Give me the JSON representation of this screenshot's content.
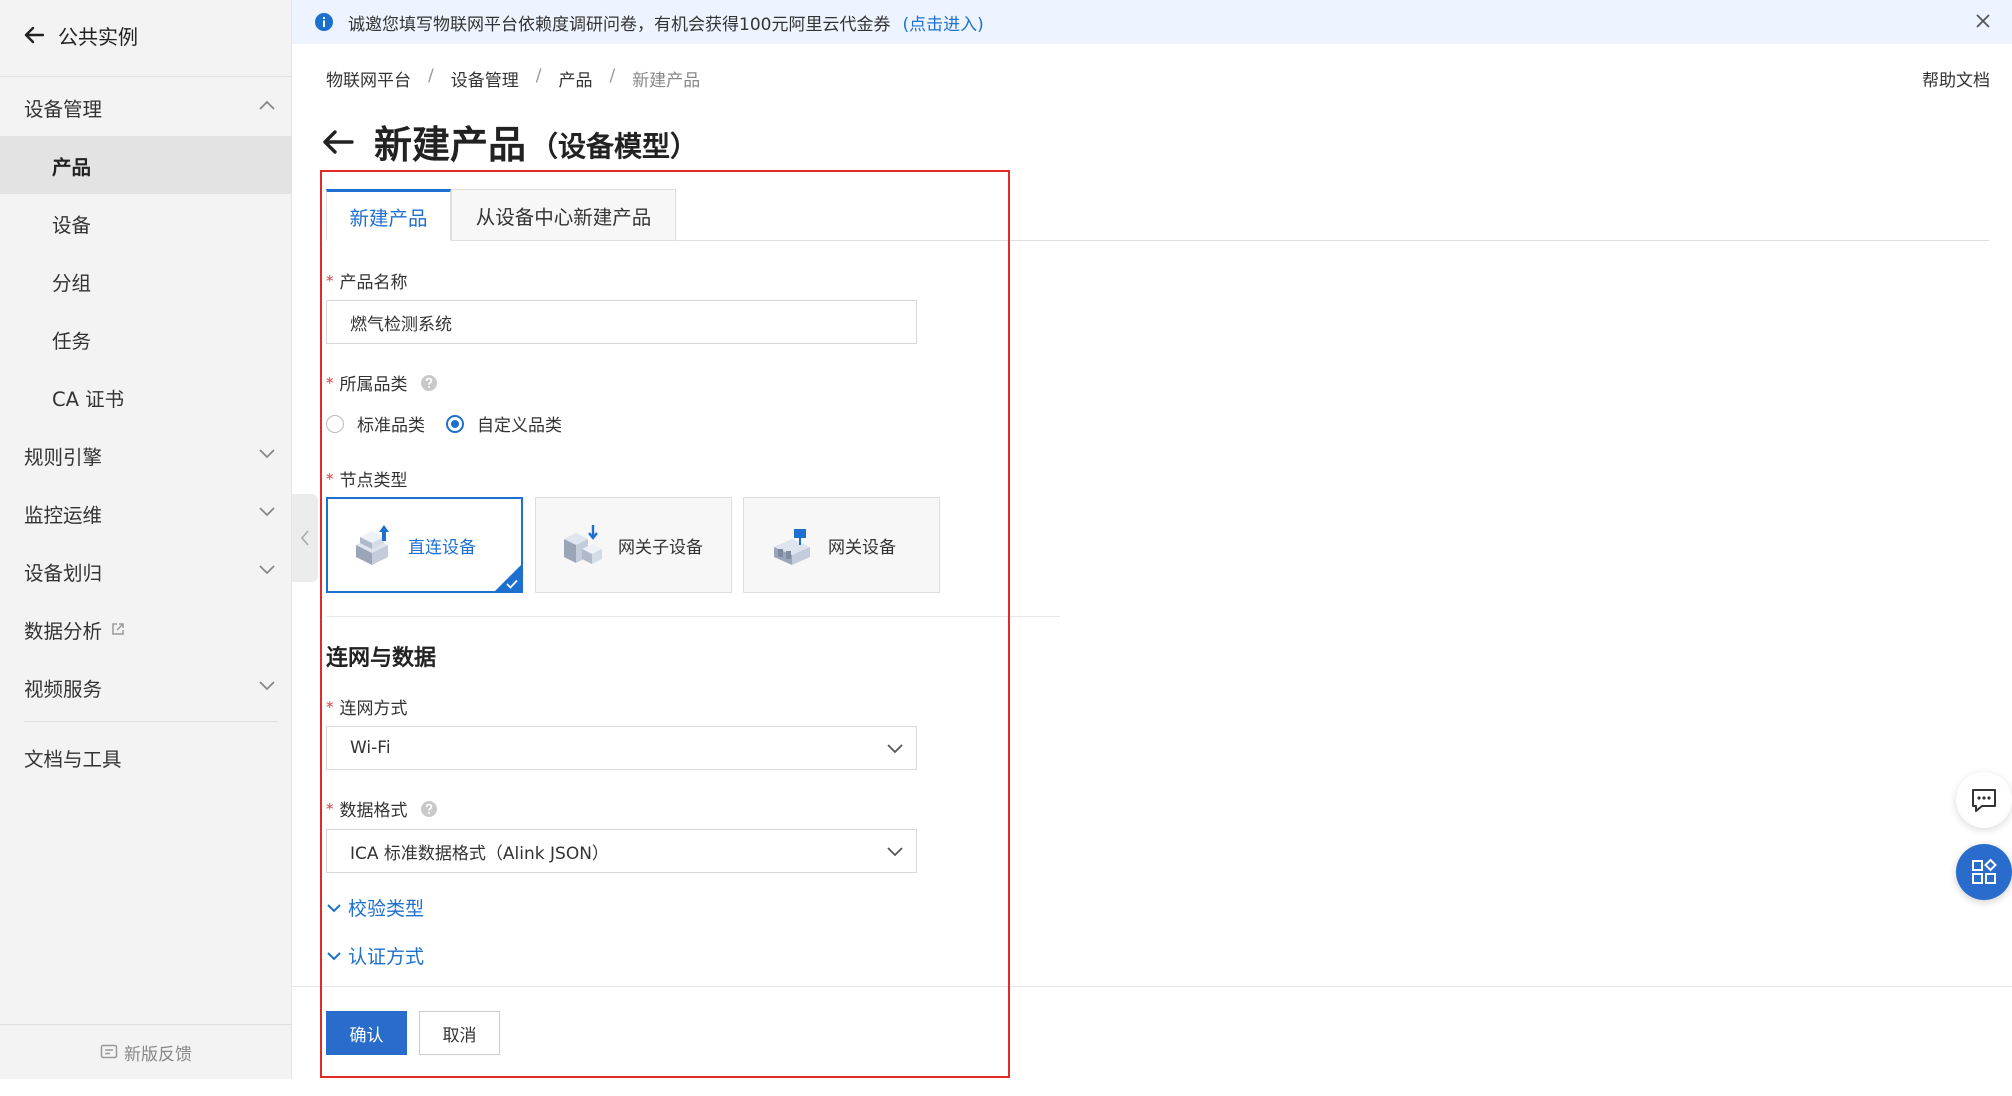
{
  "sidebar": {
    "back_label": "公共实例",
    "device_management": "设备管理",
    "items": [
      {
        "label": "产品"
      },
      {
        "label": "设备"
      },
      {
        "label": "分组"
      },
      {
        "label": "任务"
      },
      {
        "label": "CA 证书"
      }
    ],
    "groups": [
      {
        "label": "规则引擎"
      },
      {
        "label": "监控运维"
      },
      {
        "label": "设备划归"
      },
      {
        "label": "数据分析"
      },
      {
        "label": "视频服务"
      }
    ],
    "docs_tools": "文档与工具",
    "feedback": "新版反馈"
  },
  "banner": {
    "text": "诚邀您填写物联网平台依赖度调研问卷，有机会获得100元阿里云代金券",
    "link": "(点击进入)"
  },
  "breadcrumb": [
    "物联网平台",
    "设备管理",
    "产品",
    "新建产品"
  ],
  "help_label": "帮助文档",
  "title": {
    "main": "新建产品",
    "sub": "（设备模型）"
  },
  "tabs": [
    {
      "label": "新建产品"
    },
    {
      "label": "从设备中心新建产品"
    }
  ],
  "form": {
    "product_name": {
      "label": "产品名称",
      "value": "燃气检测系统"
    },
    "category": {
      "label": "所属品类",
      "options": [
        {
          "label": "标准品类",
          "selected": false
        },
        {
          "label": "自定义品类",
          "selected": true
        }
      ]
    },
    "node_type": {
      "label": "节点类型",
      "options": [
        {
          "label": "直连设备",
          "selected": true
        },
        {
          "label": "网关子设备",
          "selected": false
        },
        {
          "label": "网关设备",
          "selected": false
        }
      ]
    },
    "section_title": "连网与数据",
    "network": {
      "label": "连网方式",
      "value": "Wi-Fi"
    },
    "data_format": {
      "label": "数据格式",
      "value": "ICA 标准数据格式（Alink JSON）"
    },
    "verify_type": "校验类型",
    "auth_method": "认证方式"
  },
  "actions": {
    "ok": "确认",
    "cancel": "取消"
  },
  "colors": {
    "accent": "#1d6fd0",
    "primary_button": "#2a6ccc",
    "highlight": "#e12b2b",
    "required": "#e23b3b"
  }
}
